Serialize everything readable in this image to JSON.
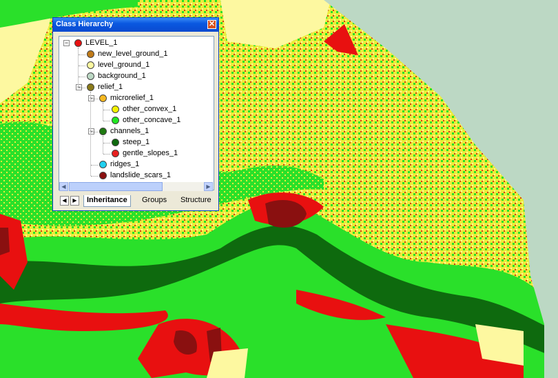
{
  "window": {
    "title": "Class Hierarchy",
    "close_icon": "close-icon"
  },
  "tree": [
    {
      "label": "LEVEL_1",
      "color": "#e81010",
      "depth": 0,
      "expander": "minus"
    },
    {
      "label": "new_level_ground_1",
      "color": "#c07a18",
      "depth": 1
    },
    {
      "label": "level_ground_1",
      "color": "#fdf8a0",
      "depth": 1
    },
    {
      "label": "background_1",
      "color": "#bcd8c4",
      "depth": 1
    },
    {
      "label": "relief_1",
      "color": "#8a7a1a",
      "depth": 1,
      "expander": "minus"
    },
    {
      "label": "microrelief_1",
      "color": "#f6b820",
      "depth": 2,
      "expander": "minus"
    },
    {
      "label": "other_convex_1",
      "color": "#f2f000",
      "depth": 3
    },
    {
      "label": "other_concave_1",
      "color": "#22e822",
      "depth": 3
    },
    {
      "label": "channels_1",
      "color": "#1e7a10",
      "depth": 2,
      "expander": "minus"
    },
    {
      "label": "steep_1",
      "color": "#0e6a0e",
      "depth": 3
    },
    {
      "label": "gentle_slopes_1",
      "color": "#e82020",
      "depth": 3
    },
    {
      "label": "ridges_1",
      "color": "#20d0f0",
      "depth": 2
    },
    {
      "label": "landslide_scars_1",
      "color": "#8a1010",
      "depth": 2
    }
  ],
  "tabs": [
    "Inheritance",
    "Groups",
    "Structure"
  ],
  "active_tab": "Inheritance",
  "map_colors": {
    "yellow": "#ecec3a",
    "light_yellow": "#fdf8a0",
    "green": "#22e822",
    "dark_green": "#0e6a0e",
    "red": "#e81010",
    "dark_red": "#8a1010",
    "background": "#bcd8c4"
  }
}
